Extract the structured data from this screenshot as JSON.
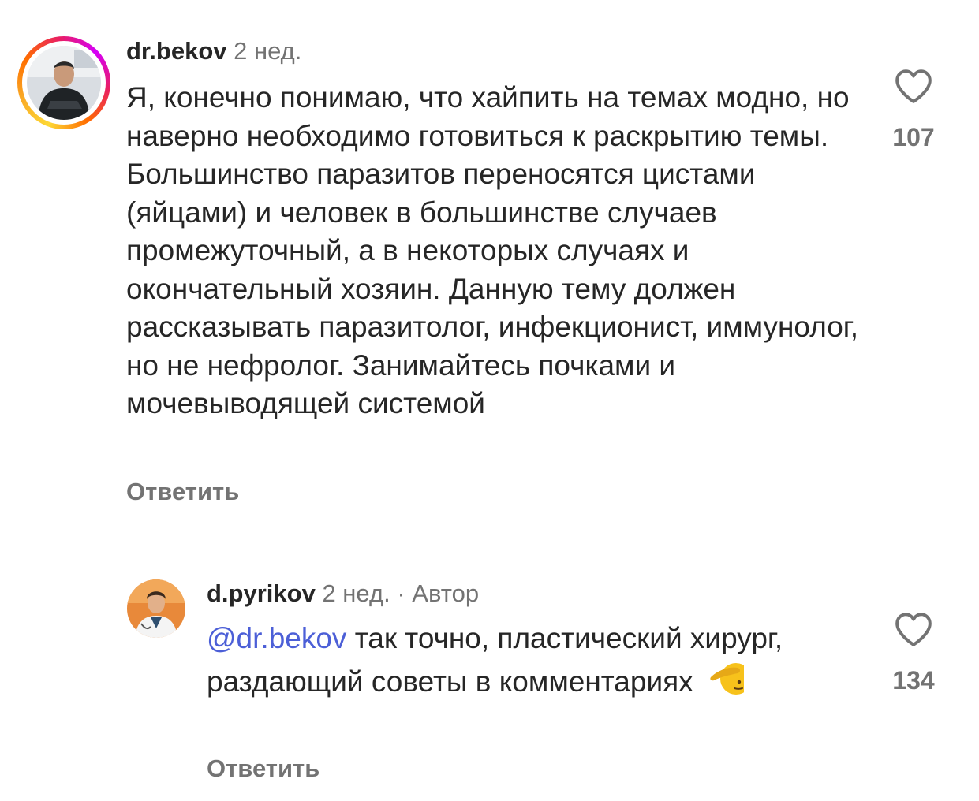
{
  "comments": [
    {
      "username": "dr.bekov",
      "time": "2 нед.",
      "text": "Я, конечно понимаю, что хайпить на темах модно, но наверно необходимо готовиться к раскрытию темы. Большинство паразитов переносятся цистами (яйцами) и человек в большинстве случаев промежуточный, а в некоторых случаях и окончательный хозяин. Данную тему должен рассказывать паразитолог, инфекционист, иммунолог, но не нефролог. Занимайтесь почками и мочевыводящей системой",
      "reply_label": "Ответить",
      "likes": "107",
      "has_story_ring": true
    },
    {
      "username": "d.pyrikov",
      "time": "2 нед.",
      "separator": "·",
      "author_tag": "Автор",
      "mention": "@dr.bekov",
      "text": "так точно, пластический хирург, раздающий советы в комментариях",
      "emoji": "saluting-face",
      "reply_label": "Ответить",
      "likes": "134",
      "has_story_ring": false
    }
  ],
  "colors": {
    "text_primary": "#262626",
    "text_secondary": "#737373",
    "mention": "#4c5fd7",
    "background": "#ffffff"
  },
  "icons": {
    "like": "heart-outline-icon"
  }
}
